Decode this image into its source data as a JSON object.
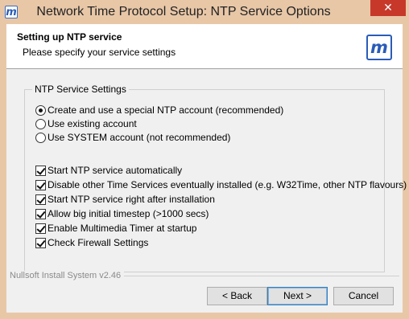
{
  "window": {
    "title": "Network Time Protocol Setup: NTP Service Options",
    "close_glyph": "✕",
    "icon": "meinberg-app-icon",
    "frame_color": "#e8c7a7",
    "close_color": "#c7382b"
  },
  "header": {
    "title": "Setting up NTP service",
    "subtitle": "Please specify your service settings",
    "logo_glyph": "m",
    "logo_color": "#2a5cb8"
  },
  "group": {
    "legend": "NTP Service Settings",
    "radios": [
      {
        "label": "Create and use a special NTP account  (recommended)",
        "selected": true
      },
      {
        "label": "Use existing account",
        "selected": false
      },
      {
        "label": "Use SYSTEM account (not recommended)",
        "selected": false
      }
    ],
    "checkboxes": [
      {
        "label": "Start NTP service automatically",
        "checked": true
      },
      {
        "label": "Disable other Time Services eventually installed (e.g. W32Time, other NTP flavours)",
        "checked": true
      },
      {
        "label": "Start NTP service right after installation",
        "checked": true
      },
      {
        "label": "Allow big initial timestep (>1000 secs)",
        "checked": true
      },
      {
        "label": "Enable Multimedia Timer at startup",
        "checked": true
      },
      {
        "label": "Check Firewall Settings",
        "checked": true
      }
    ]
  },
  "footer": {
    "branding": "Nullsoft Install System v2.46",
    "back_label": "< Back",
    "next_label": "Next >",
    "cancel_label": "Cancel"
  }
}
